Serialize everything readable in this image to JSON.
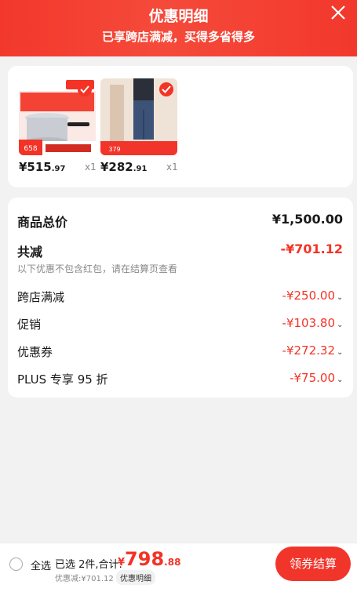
{
  "header": {
    "title": "优惠明细",
    "subtitle": "已享跨店满减，买得多省得多",
    "close_icon": "close-icon"
  },
  "products": [
    {
      "price_int": "¥515",
      "price_dec": ".97",
      "qty": "x1",
      "badge_price": "658"
    },
    {
      "price_int": "¥282",
      "price_dec": ".91",
      "qty": "x1",
      "badge_price": "379"
    }
  ],
  "summary": {
    "total_label": "商品总价",
    "total_value": "¥1,500.00",
    "reduce_label": "共减",
    "reduce_value": "-¥701.12",
    "note": "以下优惠不包含红包，请在结算页查看",
    "items": [
      {
        "label": "跨店满减",
        "value": "-¥250.00"
      },
      {
        "label": "促销",
        "value": "-¥103.80"
      },
      {
        "label": "优惠券",
        "value": "-¥272.32"
      },
      {
        "label": "PLUS 专享 95 折",
        "value": "-¥75.00"
      }
    ]
  },
  "footer": {
    "select_all": "全选",
    "selected": "已选 2件,合计:",
    "yen": "¥",
    "total_int": "798",
    "total_dec": ".88",
    "discount_line": "优惠减:¥701.12",
    "detail_tag": "优惠明细",
    "cta": "领券结算"
  },
  "colors": {
    "accent": "#f33326",
    "header": "#f2382c"
  }
}
